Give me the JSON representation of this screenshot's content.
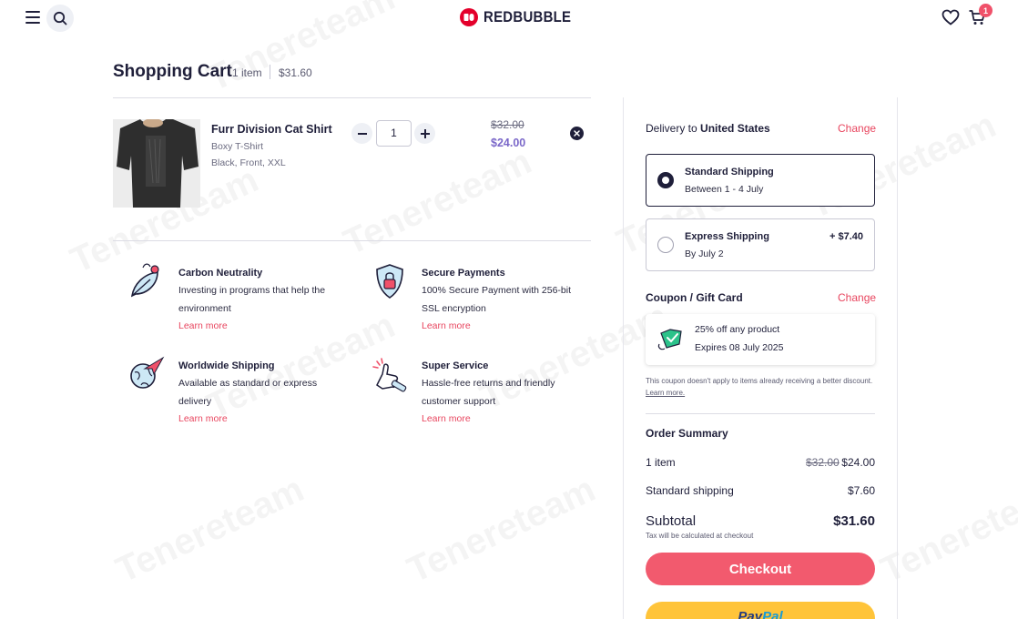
{
  "header": {
    "brand": "REDBUBBLE",
    "cart_badge": "1",
    "menu_icon": "hamburger-menu-icon",
    "search_icon": "search-icon",
    "wishlist_icon": "heart-icon",
    "cart_icon": "cart-icon"
  },
  "cart": {
    "title": "Shopping Cart",
    "item_count": "1 item",
    "total": "$31.60"
  },
  "item": {
    "name": "Furr Division Cat Shirt",
    "type": "Boxy T-Shirt",
    "variant": "Black, Front, XXL",
    "quantity": "1",
    "old_price": "$32.00",
    "new_price": "$24.00"
  },
  "features": [
    {
      "title": "Carbon Neutrality",
      "desc": "Investing in programs that help the environment",
      "link": "Learn more",
      "icon": "leaf-icon"
    },
    {
      "title": "Secure Payments",
      "desc": "100% Secure Payment with 256-bit SSL encryption",
      "link": "Learn more",
      "icon": "shield-lock-icon"
    },
    {
      "title": "Worldwide Shipping",
      "desc": "Available as standard or express delivery",
      "link": "Learn more",
      "icon": "globe-plane-icon"
    },
    {
      "title": "Super Service",
      "desc": "Hassle-free returns and friendly customer support",
      "link": "Learn more",
      "icon": "thumbs-up-icon"
    }
  ],
  "delivery": {
    "label": "Delivery to",
    "country": "United States",
    "change": "Change",
    "options": [
      {
        "name": "Standard Shipping",
        "date": "Between 1 - 4 July",
        "price": "",
        "selected": true
      },
      {
        "name": "Express Shipping",
        "date": "By July 2",
        "price": "+ $7.40",
        "selected": false
      }
    ]
  },
  "coupon": {
    "label": "Coupon / Gift Card",
    "change": "Change",
    "title": "25% off any product",
    "expires": "Expires 08 July 2025",
    "note": "This coupon doesn't apply to items already receiving a better discount.",
    "note_link": "Learn more."
  },
  "summary": {
    "title": "Order Summary",
    "items_label": "1 item",
    "items_old": "$32.00",
    "items_value": "$24.00",
    "shipping_label": "Standard shipping",
    "shipping_value": "$7.60",
    "subtotal_label": "Subtotal",
    "subtotal_value": "$31.60",
    "tax_note": "Tax will be calculated at checkout",
    "checkout": "Checkout",
    "paypal_pay": "Pay",
    "paypal_pal": "Pal"
  },
  "colors": {
    "accent": "#f25a6e",
    "price_purple": "#7b68c9",
    "paypal": "#ffc43a",
    "navy": "#1f1f3a"
  }
}
